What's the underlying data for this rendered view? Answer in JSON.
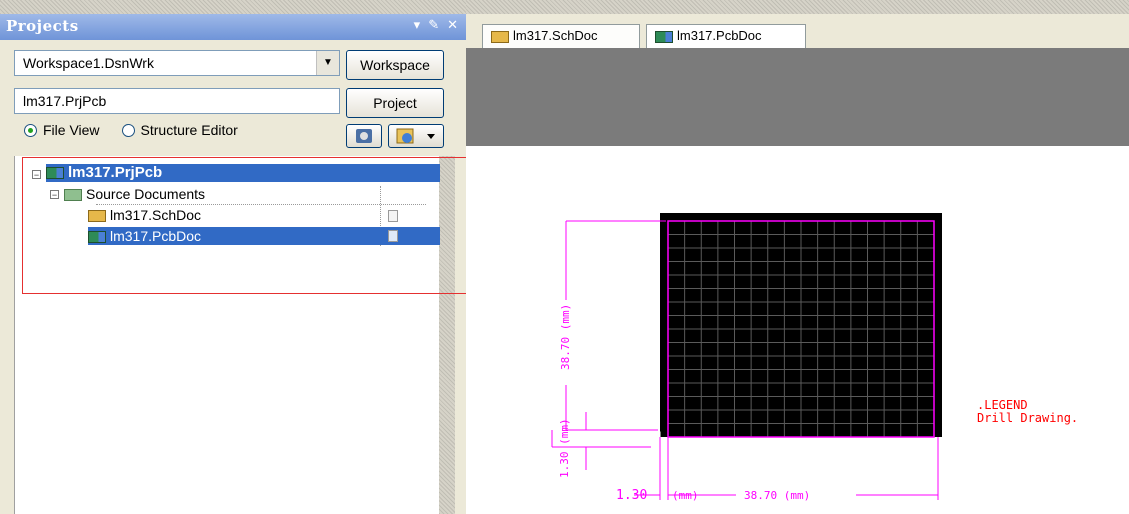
{
  "panel": {
    "title": "Projects",
    "workspace_value": "Workspace1.DsnWrk",
    "workspace_button": "Workspace",
    "project_value": "lm317.PrjPcb",
    "project_button": "Project",
    "view_options": [
      {
        "label": "File View",
        "selected": true
      },
      {
        "label": "Structure Editor",
        "selected": false
      }
    ]
  },
  "tree": {
    "project": "lm317.PrjPcb",
    "folder": "Source Documents",
    "files": [
      "lm317.SchDoc",
      "lm317.PcbDoc"
    ],
    "selected_file": "lm317.PcbDoc"
  },
  "tabs": [
    {
      "label": "lm317.SchDoc",
      "icon": "schematic-icon"
    },
    {
      "label": "lm317.PcbDoc",
      "icon": "pcb-icon",
      "active": true
    }
  ],
  "drawing": {
    "dim_vertical": "38.70 (mm)",
    "dim_horizontal": "38.70 (mm)",
    "dim_offset_v": "1.30 (mm)",
    "dim_offset_h_value": "1.30",
    "dim_offset_h_unit": "(mm)",
    "legend_title": ".LEGEND",
    "legend_subtitle": "Drill Drawing.",
    "grid_divisions": 16
  },
  "colors": {
    "selection": "#316ac5",
    "board": "#000000",
    "dimension": "#ff00ff",
    "legend_text": "#ff0000",
    "highlight_box": "#e53030"
  }
}
